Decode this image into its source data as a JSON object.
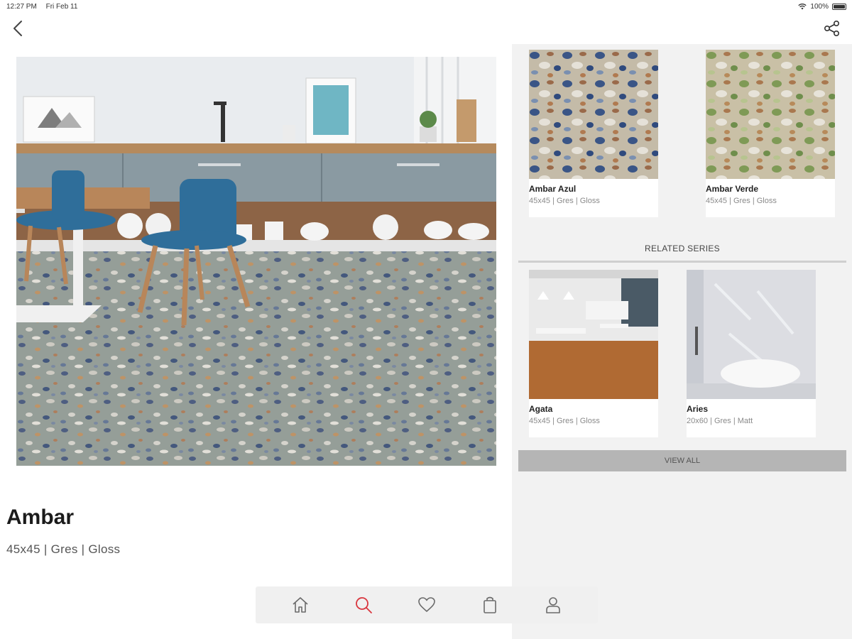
{
  "status_bar": {
    "time": "12:27 PM",
    "date": "Fri Feb 11",
    "battery": "100%"
  },
  "icons": {
    "back": "chevron-left-icon",
    "share": "share-icon",
    "nav": [
      "home-icon",
      "search-icon",
      "heart-icon",
      "bag-icon",
      "user-icon"
    ]
  },
  "colors": {
    "nav_active": "#d9363e",
    "nav_inactive": "#6b6b6b",
    "view_all_bg": "#b5b5b5"
  },
  "product": {
    "title": "Ambar",
    "specs": "45x45  |  Gres  |  Gloss"
  },
  "variants": [
    {
      "title": "Ambar Azul",
      "specs": "45x45 | Gres | Gloss"
    },
    {
      "title": "Ambar Verde",
      "specs": "45x45 | Gres | Gloss"
    }
  ],
  "related": {
    "header": "RELATED SERIES",
    "items": [
      {
        "title": "Agata",
        "specs": "45x45 | Gres | Gloss"
      },
      {
        "title": "Aries",
        "specs": "20x60 | Gres | Matt"
      }
    ],
    "view_all_label": "VIEW ALL"
  },
  "bottom_nav": {
    "active_index": 1
  }
}
